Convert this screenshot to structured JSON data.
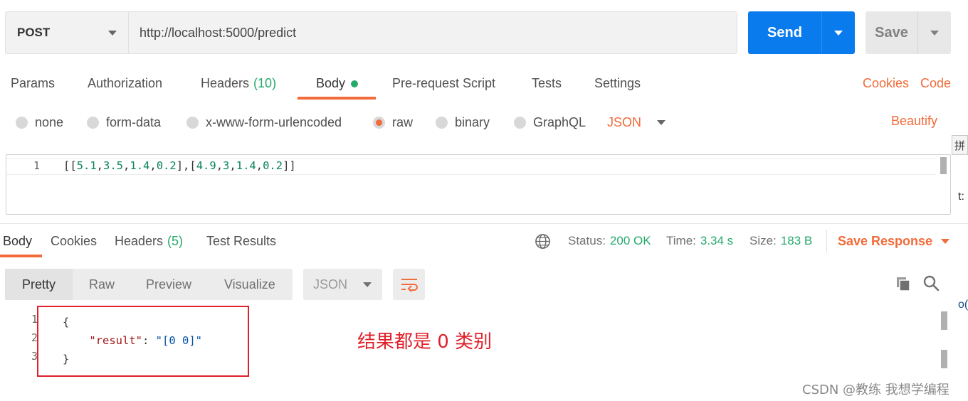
{
  "request": {
    "method": "POST",
    "url": "http://localhost:5000/predict",
    "send_label": "Send",
    "save_label": "Save"
  },
  "req_tabs": [
    {
      "label": "Params"
    },
    {
      "label": "Authorization"
    },
    {
      "label": "Headers",
      "count": "(10)"
    },
    {
      "label": "Body"
    },
    {
      "label": "Pre-request Script"
    },
    {
      "label": "Tests"
    },
    {
      "label": "Settings"
    }
  ],
  "links": {
    "cookies": "Cookies",
    "code": "Code",
    "beautify": "Beautify"
  },
  "body_types": [
    {
      "label": "none"
    },
    {
      "label": "form-data"
    },
    {
      "label": "x-www-form-urlencoded"
    },
    {
      "label": "raw"
    },
    {
      "label": "binary"
    },
    {
      "label": "GraphQL"
    }
  ],
  "body_format": "JSON",
  "editor": {
    "line": "1",
    "code": "[[5.1,3.5,1.4,0.2],[4.9,3,1.4,0.2]]"
  },
  "side": {
    "pin": "拼",
    "t": "t:",
    "o": "o("
  },
  "resp_tabs": [
    {
      "label": "Body"
    },
    {
      "label": "Cookies"
    },
    {
      "label": "Headers",
      "count": "(5)"
    },
    {
      "label": "Test Results"
    }
  ],
  "status": {
    "status_label": "Status:",
    "status_value": "200 OK",
    "time_label": "Time:",
    "time_value": "3.34 s",
    "size_label": "Size:",
    "size_value": "183 B",
    "save_response": "Save Response"
  },
  "view_modes": [
    {
      "label": "Pretty"
    },
    {
      "label": "Raw"
    },
    {
      "label": "Preview"
    },
    {
      "label": "Visualize"
    }
  ],
  "response_format": "JSON",
  "response": {
    "line_numbers": [
      "1",
      "2",
      "3"
    ],
    "open": "{",
    "key": "\"result\"",
    "colon": ": ",
    "value": "\"[0 0]\"",
    "close": "}"
  },
  "annotation": "结果都是 0 类别",
  "watermark": "CSDN @教练 我想学编程",
  "colors": {
    "accent": "#f26b3a",
    "send": "#097bed",
    "success": "#26a96d",
    "annotation": "#e0202a"
  },
  "icons": [
    "chevron-down-icon",
    "globe-icon",
    "wrap-lines-icon",
    "copy-icon",
    "search-icon"
  ]
}
